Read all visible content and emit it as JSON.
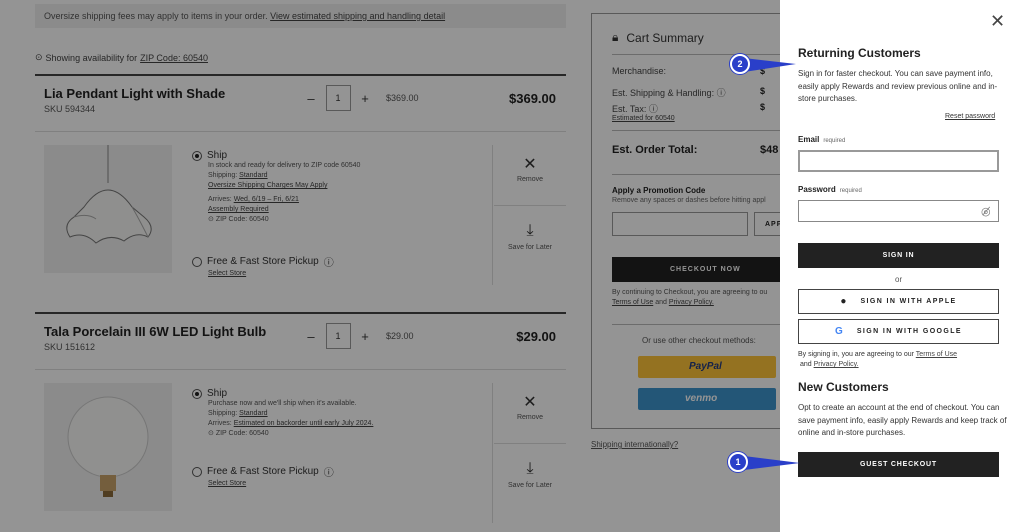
{
  "banner": {
    "text": "Oversize shipping fees may apply to items in your order.",
    "link": "View estimated shipping and handling detail"
  },
  "availability": {
    "prefix": "Showing availability for",
    "zip_link": "ZIP Code: 60540"
  },
  "items": [
    {
      "name": "Lia Pendant Light with Shade",
      "sku": "SKU 594344",
      "qty": "1",
      "unit_price": "$369.00",
      "total": "$369.00",
      "ship_label": "Ship",
      "ship_lines": [
        "In stock and ready for delivery to ZIP code 60540"
      ],
      "shipping_prefix": "Shipping:",
      "shipping_method": "Standard",
      "oversize_link": "Oversize Shipping Charges May Apply",
      "arrives_prefix": "Arrives:",
      "arrives_value": "Wed, 6/19 – Fri, 6/21",
      "assembly_link": "Assembly Required",
      "zip_line": "ZIP Code: 60540",
      "pickup_label": "Free & Fast Store Pickup",
      "select_store": "Select Store",
      "remove": "Remove",
      "save_later": "Save for Later"
    },
    {
      "name": "Tala Porcelain III 6W LED Light Bulb",
      "sku": "SKU 151612",
      "qty": "1",
      "unit_price": "$29.00",
      "total": "$29.00",
      "ship_label": "Ship",
      "ship_lines": [
        "Purchase now and we'll ship when it's available."
      ],
      "shipping_prefix": "Shipping:",
      "shipping_method": "Standard",
      "arrives_prefix": "Arrives:",
      "arrives_value": "Estimated on backorder until early July 2024.",
      "zip_line": "ZIP Code: 60540",
      "pickup_label": "Free & Fast Store Pickup",
      "select_store": "Select Store",
      "remove": "Remove",
      "save_later": "Save for Later"
    }
  ],
  "cart": {
    "title": "Cart Summary",
    "merchandise": "Merchandise:",
    "shipping": "Est. Shipping & Handling:",
    "tax": "Est. Tax:",
    "tax_link": "Estimated for 60540",
    "val1": "$",
    "val2": "$",
    "val3": "$",
    "order_total_label": "Est. Order Total:",
    "order_total_value": "$48",
    "promo_title": "Apply a Promotion Code",
    "promo_sub": "Remove any spaces or dashes before hitting appl",
    "promo_btn": "APP",
    "checkout": "CHECKOUT NOW",
    "terms_1": "By continuing to Checkout, you are agreeing to ou",
    "terms_link1": "Terms of Use",
    "terms_and": "and",
    "terms_link2": "Privacy Policy.",
    "other": "Or use other checkout methods:",
    "paypal": "PayPal",
    "venmo": "venmo",
    "international": "Shipping internationally?"
  },
  "drawer": {
    "returning_title": "Returning Customers",
    "returning_text": "Sign in for faster checkout. You can save payment info, easily apply Rewards and review previous online and in-store purchases.",
    "reset_password": "Reset password",
    "email_label": "Email",
    "password_label": "Password",
    "required": "required",
    "email_value": "",
    "password_value": "",
    "sign_in": "SIGN IN",
    "or": "or",
    "apple": "SIGN IN WITH APPLE",
    "google": "SIGN IN WITH GOOGLE",
    "agree_prefix": "By signing in, you are agreeing to our",
    "terms": "Terms of Use",
    "and": "and",
    "privacy": "Privacy Policy.",
    "new_title": "New Customers",
    "new_text": "Opt to create an account at the end of checkout. You can save payment info, easily apply Rewards and keep track of online and in-store purchases.",
    "guest": "GUEST CHECKOUT"
  },
  "markers": {
    "one": "1",
    "two": "2"
  },
  "colors": {
    "marker": "#2a3fc9",
    "dark_button": "#222222",
    "paypal": "#ffc439",
    "venmo": "#3d95ce"
  },
  "icons": [
    "close-icon",
    "lock-icon",
    "location-pin-icon",
    "help-icon",
    "remove-x-icon",
    "save-download-icon",
    "eye-slash-icon",
    "apple-icon",
    "google-icon"
  ]
}
